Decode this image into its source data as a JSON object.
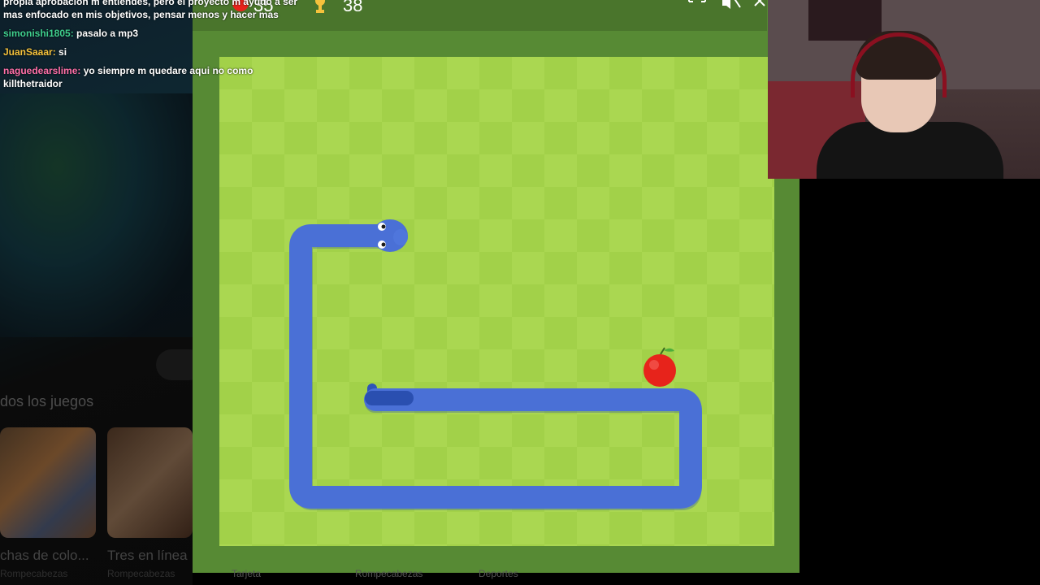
{
  "chat": [
    {
      "user": "",
      "user_color": "#ffffff",
      "text": "propia aprobacion m entiendes, pero el proyecto m ayudo a ser",
      "continuation": "mas enfocado en mis objetivos, pensar menos y hacer mas"
    },
    {
      "user": "simonishi1805:",
      "user_color": "#3fcf8e",
      "text": "pasalo a mp3",
      "continuation": ""
    },
    {
      "user": "JuanSaaar:",
      "user_color": "#f5c23c",
      "text": "si",
      "continuation": ""
    },
    {
      "user": "naguedearslime:",
      "user_color": "#ff6fa8",
      "text": "yo siempre m quedare aqui no como",
      "continuation": "killthetraidor"
    }
  ],
  "game": {
    "apples_eaten": "35",
    "high_score": "38",
    "board_cols": 17,
    "board_rows": 15
  },
  "background_page": {
    "section_title": "dos los juegos",
    "games": [
      {
        "title": "chas de colo...",
        "category": "Rompecabezas"
      },
      {
        "title": "Tres en línea",
        "category": "Rompecabezas"
      }
    ],
    "more_categories": [
      "Tarjeta",
      "Rompecabezas",
      "Deportes"
    ]
  },
  "colors": {
    "snake": "#4a70d6",
    "apple": "#e7231b",
    "board_light": "#aad751",
    "board_dark": "#a2d149",
    "frame": "#578a34",
    "header": "#4a752c"
  }
}
